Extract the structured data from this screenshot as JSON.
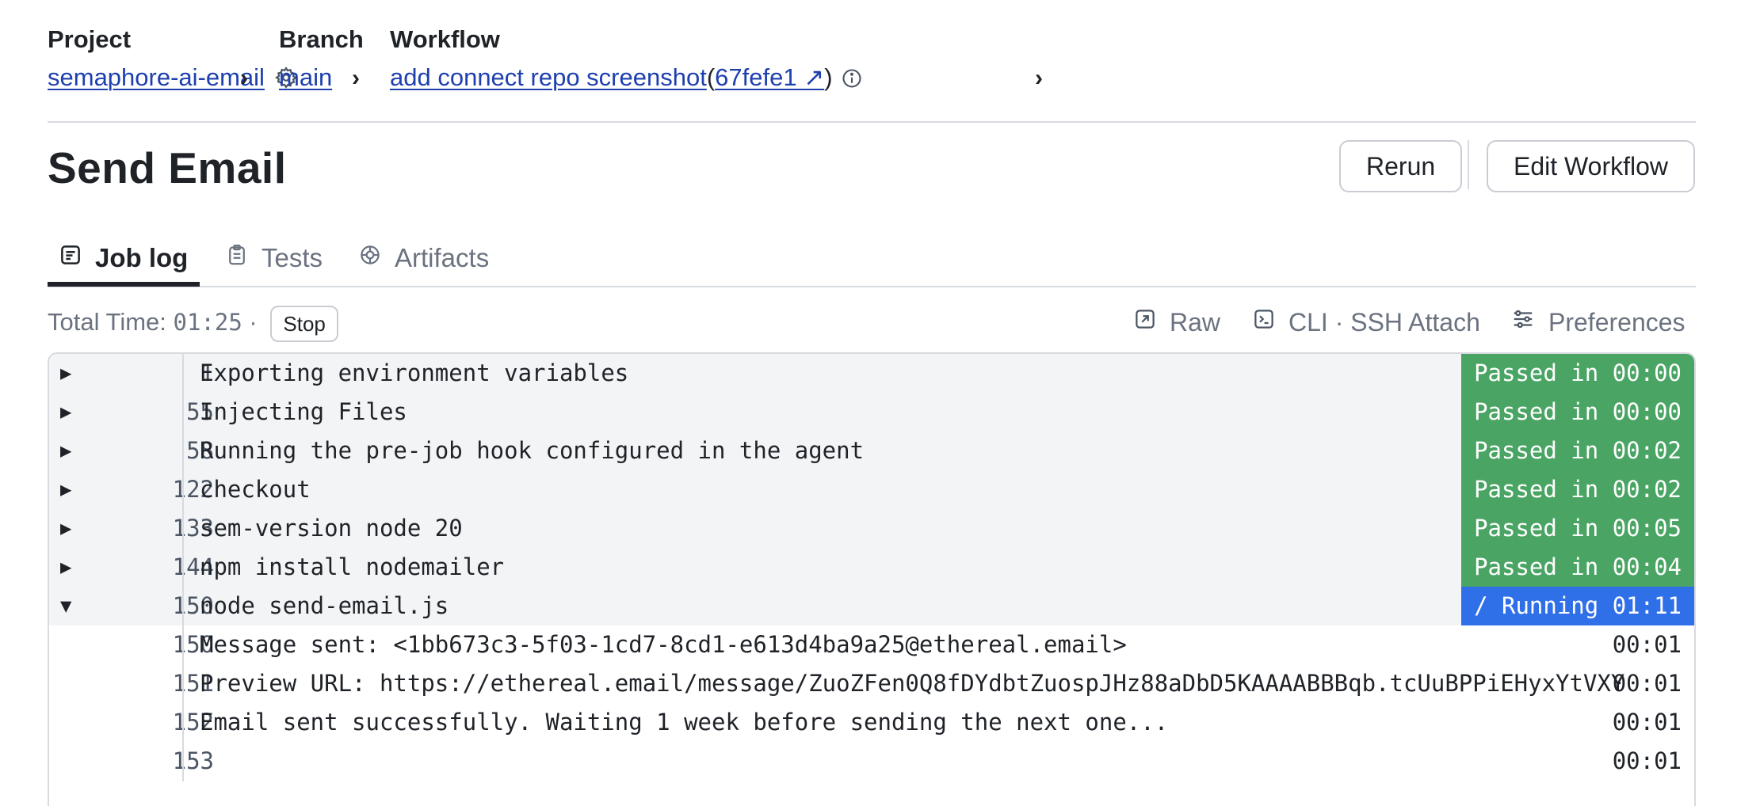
{
  "breadcrumb": {
    "project_label": "Project",
    "project_value": "semaphore-ai-email",
    "branch_label": "Branch",
    "branch_value": "main",
    "workflow_label": "Workflow",
    "workflow_value": "add connect repo screenshot",
    "commit_open": "(",
    "commit_value": "67fefe1 ↗",
    "commit_close": ")",
    "chevron": "›"
  },
  "header": {
    "title": "Send Email",
    "rerun_label": "Rerun",
    "edit_label": "Edit Workflow"
  },
  "tabs": [
    {
      "label": "Job log",
      "icon": "job-log-icon",
      "active": true
    },
    {
      "label": "Tests",
      "icon": "clipboard-icon",
      "active": false
    },
    {
      "label": "Artifacts",
      "icon": "artifacts-icon",
      "active": false
    }
  ],
  "toolbar": {
    "total_label": "Total Time: ",
    "total_time": "01:25",
    "total_sep": " ·",
    "stop_label": "Stop",
    "raw_label": "Raw",
    "cli_label": "CLI · SSH Attach",
    "prefs_label": "Preferences"
  },
  "log": {
    "commands": [
      {
        "toggle": "▶",
        "line": "1",
        "text": "Exporting environment variables",
        "status": "Passed in 00:00"
      },
      {
        "toggle": "▶",
        "line": "55",
        "text": "Injecting Files",
        "status": "Passed in 00:00"
      },
      {
        "toggle": "▶",
        "line": "58",
        "text": "Running the pre-job hook configured in the agent",
        "status": "Passed in 00:02"
      },
      {
        "toggle": "▶",
        "line": "122",
        "text": "checkout",
        "status": "Passed in 00:02"
      },
      {
        "toggle": "▶",
        "line": "133",
        "text": "sem-version node 20",
        "status": "Passed in 00:05"
      },
      {
        "toggle": "▶",
        "line": "144",
        "text": "npm install nodemailer",
        "status": "Passed in 00:04"
      },
      {
        "toggle": "▼",
        "line": "150",
        "text": "node send-email.js",
        "status": "/ Running 01:11"
      }
    ],
    "output": [
      {
        "line": "150",
        "text": "Message sent: <1bb673c3-5f03-1cd7-8cd1-e613d4ba9a25@ethereal.email>",
        "time": "00:01"
      },
      {
        "line": "151",
        "text": "Preview URL: https://ethereal.email/message/ZuoZFen0Q8fDYdbtZuospJHz88aDbD5KAAAABBBqb.tcUuBPPiEHyxYtVXY",
        "time": "00:01"
      },
      {
        "line": "152",
        "text": "Email sent successfully. Waiting 1 week before sending the next one...",
        "time": "00:01"
      },
      {
        "line": "153",
        "text": "",
        "time": "00:01"
      }
    ]
  },
  "colors": {
    "passed": "#4aa564",
    "running": "#2f6fe8",
    "link": "#1e40af"
  }
}
